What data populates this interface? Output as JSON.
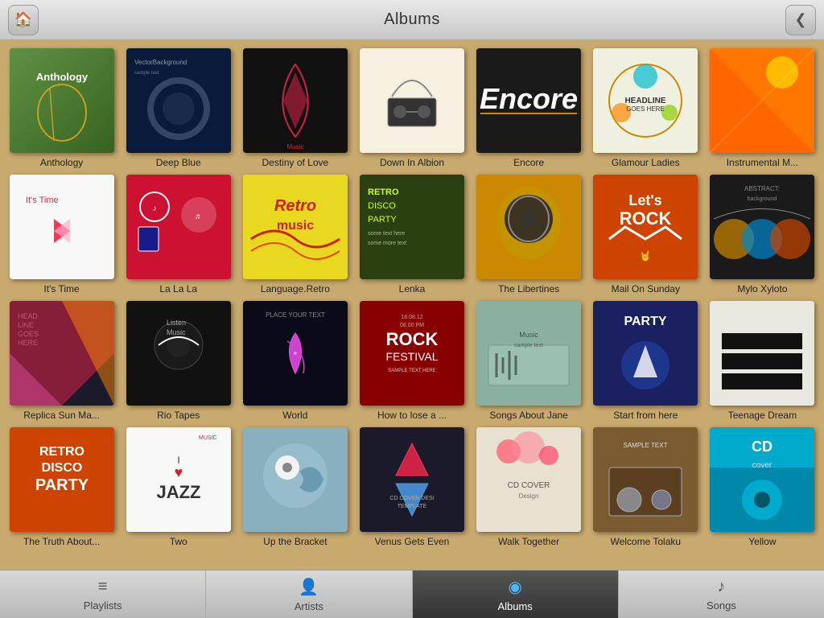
{
  "header": {
    "title": "Albums",
    "home_icon": "🏠",
    "back_icon": "❮"
  },
  "albums": [
    {
      "id": "anthology",
      "title": "Anthology",
      "cover_class": "cover-anthology"
    },
    {
      "id": "deep-blue",
      "title": "Deep Blue",
      "cover_class": "cover-deep-blue"
    },
    {
      "id": "destiny",
      "title": "Destiny of Love",
      "cover_class": "cover-destiny"
    },
    {
      "id": "down-albion",
      "title": "Down In Albion",
      "cover_class": "cover-down-in-albion"
    },
    {
      "id": "encore",
      "title": "Encore",
      "cover_class": "cover-encore"
    },
    {
      "id": "glamour",
      "title": "Glamour Ladies",
      "cover_class": "cover-glamour"
    },
    {
      "id": "instrumental",
      "title": "Instrumental M...",
      "cover_class": "cover-instrumental"
    },
    {
      "id": "its-time",
      "title": "It's Time",
      "cover_class": "cover-its-time"
    },
    {
      "id": "la-la",
      "title": "La La La",
      "cover_class": "cover-la-la"
    },
    {
      "id": "language",
      "title": "Language.Retro",
      "cover_class": "cover-language"
    },
    {
      "id": "lenka",
      "title": "Lenka",
      "cover_class": "cover-lenka"
    },
    {
      "id": "libertines",
      "title": "The Libertines",
      "cover_class": "cover-libertines"
    },
    {
      "id": "mail",
      "title": "Mail On Sunday",
      "cover_class": "cover-mail"
    },
    {
      "id": "mylo",
      "title": "Mylo Xyloto",
      "cover_class": "cover-mylo"
    },
    {
      "id": "replica",
      "title": "Replica Sun Ma...",
      "cover_class": "cover-replica"
    },
    {
      "id": "rio",
      "title": "Rio Tapes",
      "cover_class": "cover-rio"
    },
    {
      "id": "world",
      "title": "World",
      "cover_class": "cover-world"
    },
    {
      "id": "lose",
      "title": "How to lose a ...",
      "cover_class": "cover-lose"
    },
    {
      "id": "songs-jane",
      "title": "Songs About Jane",
      "cover_class": "cover-songs-jane"
    },
    {
      "id": "start",
      "title": "Start from here",
      "cover_class": "cover-start"
    },
    {
      "id": "teenage",
      "title": "Teenage Dream",
      "cover_class": "cover-teenage"
    },
    {
      "id": "truth",
      "title": "The Truth About...",
      "cover_class": "cover-truth"
    },
    {
      "id": "two",
      "title": "Two",
      "cover_class": "cover-two"
    },
    {
      "id": "up-bracket",
      "title": "Up the Bracket",
      "cover_class": "cover-up-bracket"
    },
    {
      "id": "venus",
      "title": "Venus Gets Even",
      "cover_class": "cover-venus"
    },
    {
      "id": "walk",
      "title": "Walk Together",
      "cover_class": "cover-walk"
    },
    {
      "id": "welcome",
      "title": "Welcome Tolaku",
      "cover_class": "cover-welcome"
    },
    {
      "id": "yellow",
      "title": "Yellow",
      "cover_class": "cover-yellow"
    }
  ],
  "tabs": [
    {
      "id": "playlists",
      "label": "Playlists",
      "icon": "≡",
      "active": false
    },
    {
      "id": "artists",
      "label": "Artists",
      "icon": "👤",
      "active": false
    },
    {
      "id": "albums",
      "label": "Albums",
      "icon": "◉",
      "active": true
    },
    {
      "id": "songs",
      "label": "Songs",
      "icon": "♪",
      "active": false
    }
  ]
}
